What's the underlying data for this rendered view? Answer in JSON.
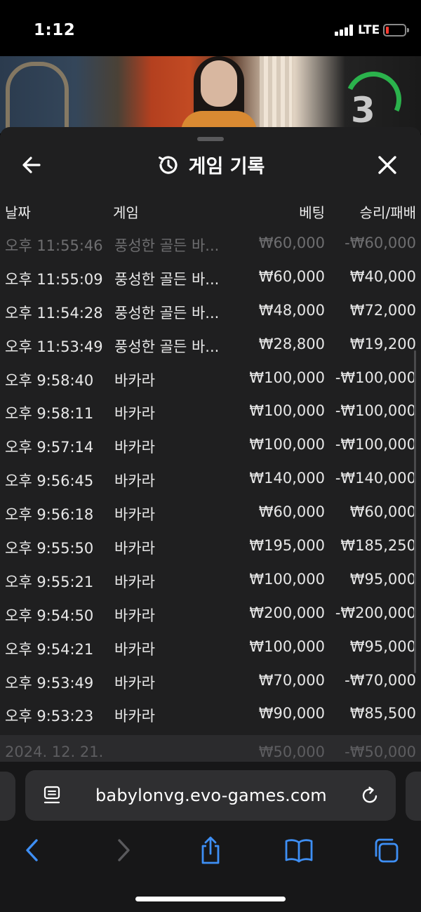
{
  "status_bar": {
    "time": "1:12",
    "network": "LTE"
  },
  "video": {
    "countdown": "3"
  },
  "history": {
    "title": "게임 기록",
    "columns": {
      "date": "날짜",
      "game": "게임",
      "bet": "베팅",
      "result": "승리/패배"
    },
    "rows": [
      {
        "date": "오후 11:55:46",
        "game": "풍성한 골든 바...",
        "bet": "₩60,000",
        "result": "-₩60,000"
      },
      {
        "date": "오후 11:55:09",
        "game": "풍성한 골든 바...",
        "bet": "₩60,000",
        "result": "₩40,000"
      },
      {
        "date": "오후 11:54:28",
        "game": "풍성한 골든 바...",
        "bet": "₩48,000",
        "result": "₩72,000"
      },
      {
        "date": "오후 11:53:49",
        "game": "풍성한 골든 바...",
        "bet": "₩28,800",
        "result": "₩19,200"
      },
      {
        "date": "오후 9:58:40",
        "game": "바카라",
        "bet": "₩100,000",
        "result": "-₩100,000"
      },
      {
        "date": "오후 9:58:11",
        "game": "바카라",
        "bet": "₩100,000",
        "result": "-₩100,000"
      },
      {
        "date": "오후 9:57:14",
        "game": "바카라",
        "bet": "₩100,000",
        "result": "-₩100,000"
      },
      {
        "date": "오후 9:56:45",
        "game": "바카라",
        "bet": "₩140,000",
        "result": "-₩140,000"
      },
      {
        "date": "오후 9:56:18",
        "game": "바카라",
        "bet": "₩60,000",
        "result": "₩60,000"
      },
      {
        "date": "오후 9:55:50",
        "game": "바카라",
        "bet": "₩195,000",
        "result": "₩185,250"
      },
      {
        "date": "오후 9:55:21",
        "game": "바카라",
        "bet": "₩100,000",
        "result": "₩95,000"
      },
      {
        "date": "오후 9:54:50",
        "game": "바카라",
        "bet": "₩200,000",
        "result": "-₩200,000"
      },
      {
        "date": "오후 9:54:21",
        "game": "바카라",
        "bet": "₩100,000",
        "result": "₩95,000"
      },
      {
        "date": "오후 9:53:49",
        "game": "바카라",
        "bet": "₩70,000",
        "result": "-₩70,000"
      },
      {
        "date": "오후 9:53:23",
        "game": "바카라",
        "bet": "₩90,000",
        "result": "₩85,500"
      }
    ],
    "footer_row": {
      "date": "2024. 12. 21.",
      "bet": "₩50,000",
      "result": "-₩50,000"
    }
  },
  "browser": {
    "url": "babylonvg.evo-games.com"
  }
}
